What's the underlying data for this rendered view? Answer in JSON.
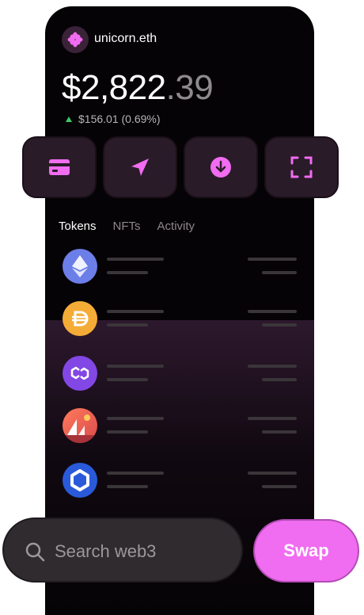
{
  "account": {
    "ens": "unicorn.eth",
    "avatar_icon": "unicorn-sparkle-icon"
  },
  "balance": {
    "whole": "$2,822",
    "cents": ".39"
  },
  "change": {
    "text": "$156.01 (0.69%)",
    "direction": "up",
    "color": "#3cc96a"
  },
  "actions": [
    {
      "name": "buy",
      "icon": "card-icon"
    },
    {
      "name": "send",
      "icon": "send-icon"
    },
    {
      "name": "receive",
      "icon": "download-icon"
    },
    {
      "name": "scan",
      "icon": "scan-icon"
    }
  ],
  "tabs": [
    {
      "label": "Tokens",
      "active": true
    },
    {
      "label": "NFTs",
      "active": false
    },
    {
      "label": "Activity",
      "active": false
    }
  ],
  "tokens": [
    {
      "icon": "ethereum-icon",
      "color": "#6c7ee8"
    },
    {
      "icon": "dai-icon",
      "color": "#f5ac37"
    },
    {
      "icon": "polygon-icon",
      "color": "#8247e5"
    },
    {
      "icon": "decentraland-icon",
      "color": "#ff6e5a"
    },
    {
      "icon": "chainlink-icon",
      "color": "#2a5ada"
    }
  ],
  "search": {
    "placeholder": "Search web3"
  },
  "swap": {
    "label": "Swap"
  },
  "colors": {
    "accent": "#f06cf0",
    "button_bg": "#2a1b29",
    "background": "#050305"
  }
}
